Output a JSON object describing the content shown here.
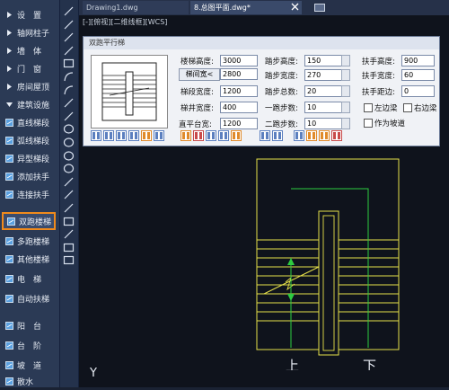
{
  "sidebar": {
    "items": [
      {
        "label": "设　置",
        "icon": "arrow-right-icon"
      },
      {
        "label": "轴网柱子",
        "icon": "arrow-right-icon"
      },
      {
        "label": "墙　体",
        "icon": "arrow-right-icon"
      },
      {
        "label": "门　窗",
        "icon": "arrow-right-icon"
      },
      {
        "label": "房间屋顶",
        "icon": "arrow-right-icon"
      },
      {
        "label": "建筑设施",
        "icon": "arrow-down-icon"
      },
      {
        "label": "直线梯段",
        "icon": "stair-icon"
      },
      {
        "label": "弧线梯段",
        "icon": "stair-icon"
      },
      {
        "label": "异型梯段",
        "icon": "stair-icon"
      },
      {
        "label": "添加扶手",
        "icon": "handrail-icon"
      },
      {
        "label": "连接扶手",
        "icon": "handrail-icon"
      },
      {
        "label": "双跑楼梯",
        "icon": "stair-icon"
      },
      {
        "label": "多跑楼梯",
        "icon": "stair-icon"
      },
      {
        "label": "其他楼梯",
        "icon": "stair-icon"
      },
      {
        "label": "电　梯",
        "icon": "elevator-icon"
      },
      {
        "label": "自动扶梯",
        "icon": "escalator-icon"
      },
      {
        "label": "阳　台",
        "icon": "balcony-icon"
      },
      {
        "label": "台　阶",
        "icon": "steps-icon"
      },
      {
        "label": "坡　道",
        "icon": "ramp-icon"
      },
      {
        "label": "散水",
        "icon": "apron-icon"
      }
    ],
    "active_index": 11
  },
  "tabs": [
    {
      "label": "Drawing1.dwg"
    },
    {
      "label": "8.总图平面.dwg*"
    }
  ],
  "viewport_label": "[-][俯视][二维线框][WCS]",
  "dialog": {
    "title": "双跑平行梯",
    "fields": [
      {
        "label": "楼梯高度:",
        "value": "3000"
      },
      {
        "label": "梯间宽<",
        "value": "2800"
      },
      {
        "label": "梯段宽度:",
        "value": "1200"
      },
      {
        "label": "梯井宽度:",
        "value": "400"
      },
      {
        "label": "直平台宽:",
        "value": "1200"
      },
      {
        "label": "踏步高度:",
        "value": "150"
      },
      {
        "label": "踏步宽度:",
        "value": "270"
      },
      {
        "label": "踏步总数:",
        "value": "20"
      },
      {
        "label": "一跑步数:",
        "value": "10"
      },
      {
        "label": "二跑步数:",
        "value": "10"
      },
      {
        "label": "扶手高度:",
        "value": "900"
      },
      {
        "label": "扶手宽度:",
        "value": "60"
      },
      {
        "label": "扶手距边:",
        "value": "0"
      }
    ],
    "checkboxes": [
      {
        "label": "左边梁"
      },
      {
        "label": "右边梁"
      },
      {
        "label": "作为坡道"
      }
    ]
  },
  "drawing": {
    "up_label": "上",
    "down_label": "下",
    "axis_label": "Y"
  },
  "colors": {
    "sidebar_bg": "#2b3a55",
    "active_outline": "#f08a1c",
    "stair_line": "#e6e04a",
    "guide_line": "#2ecc40"
  }
}
